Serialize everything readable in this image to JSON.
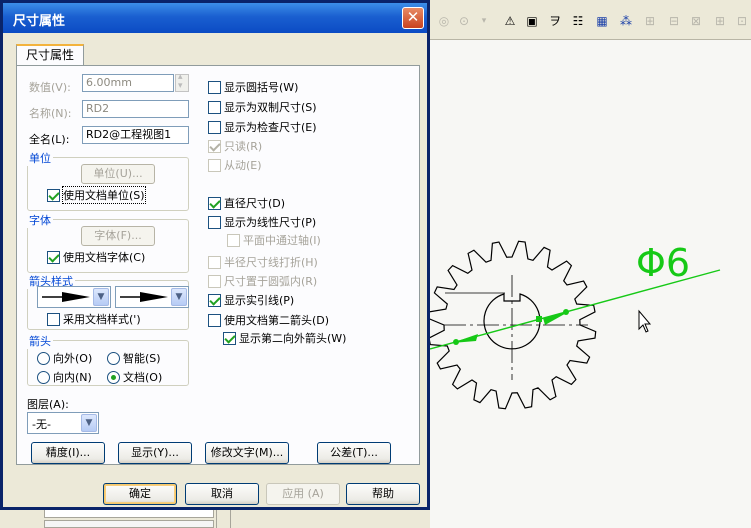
{
  "dialog": {
    "title": "尺寸属性",
    "close_glyph": "✕",
    "tab_label": "尺寸属性"
  },
  "left": {
    "value_label": "数值(V):",
    "value": "6.00mm",
    "name_label": "名称(N):",
    "name_value": "RD2",
    "fullname_label": "全名(L):",
    "fullname_value": "RD2@工程视图1",
    "unit_group": "单位",
    "unit_button": "单位(U)...",
    "use_doc_unit": "使用文档单位(S)",
    "font_group": "字体",
    "font_button": "字体(F)...",
    "use_doc_font": "使用文档字体(C)",
    "arrow_group": "箭头样式",
    "use_doc_style": "采用文档样式(')",
    "arrow_pos_group": "箭头",
    "radio_outside": "向外(O)",
    "radio_smart": "智能(S)",
    "radio_inside": "向内(N)",
    "radio_doc": "文档(O)",
    "layer_label": "图层(A):",
    "layer_value": "-无-"
  },
  "right": {
    "show_parens": "显示圆括号(W)",
    "show_dual": "显示为双制尺寸(S)",
    "show_inspection": "显示为检查尺寸(E)",
    "read_only": "只读(R)",
    "driven": "从动(E)",
    "diameter": "直径尺寸(D)",
    "show_linear": "显示为线性尺寸(P)",
    "parallel_axis": "平面中通过轴(I)",
    "radius_fold": "半径尺寸线打折(H)",
    "place_inside_arc": "尺寸置于圆弧内(R)",
    "show_leader": "显示实引线(P)",
    "use_second_arrow": "使用文档第二箭头(D)",
    "show_second_outward": "显示第二向外箭头(W)"
  },
  "buttons": {
    "precision": "精度(I)...",
    "display": "显示(Y)...",
    "modify_text": "修改文字(M)...",
    "tolerance": "公差(T)...",
    "ok": "确定",
    "cancel": "取消",
    "apply": "应用 (A)",
    "help": "帮助"
  },
  "drawing": {
    "dimension_text": "Φ6",
    "line_color": "#16c916",
    "gear_color": "#000000"
  },
  "state": {
    "use_doc_unit": true,
    "use_doc_font": true,
    "use_doc_style": false,
    "show_parens": false,
    "show_dual": false,
    "show_inspection": false,
    "read_only": true,
    "driven": false,
    "diameter": true,
    "show_linear": false,
    "parallel_axis": false,
    "radius_fold": false,
    "place_inside_arc": false,
    "show_leader": true,
    "use_second_arrow": false,
    "show_second_outward": true,
    "arrow_position": "文档(O)"
  },
  "toolbar_icons": [
    "circle-icon",
    "note-icon",
    "surface-finish-icon",
    "datum-icon",
    "geometric-tolerance-icon",
    "hole-callout-icon",
    "grid-icon",
    "cosmetic-thread-icon",
    "align-icon",
    "area-hatch-icon",
    "block-icon",
    "centerline-icon",
    "center-mark-icon",
    "weld-symbol-icon"
  ]
}
